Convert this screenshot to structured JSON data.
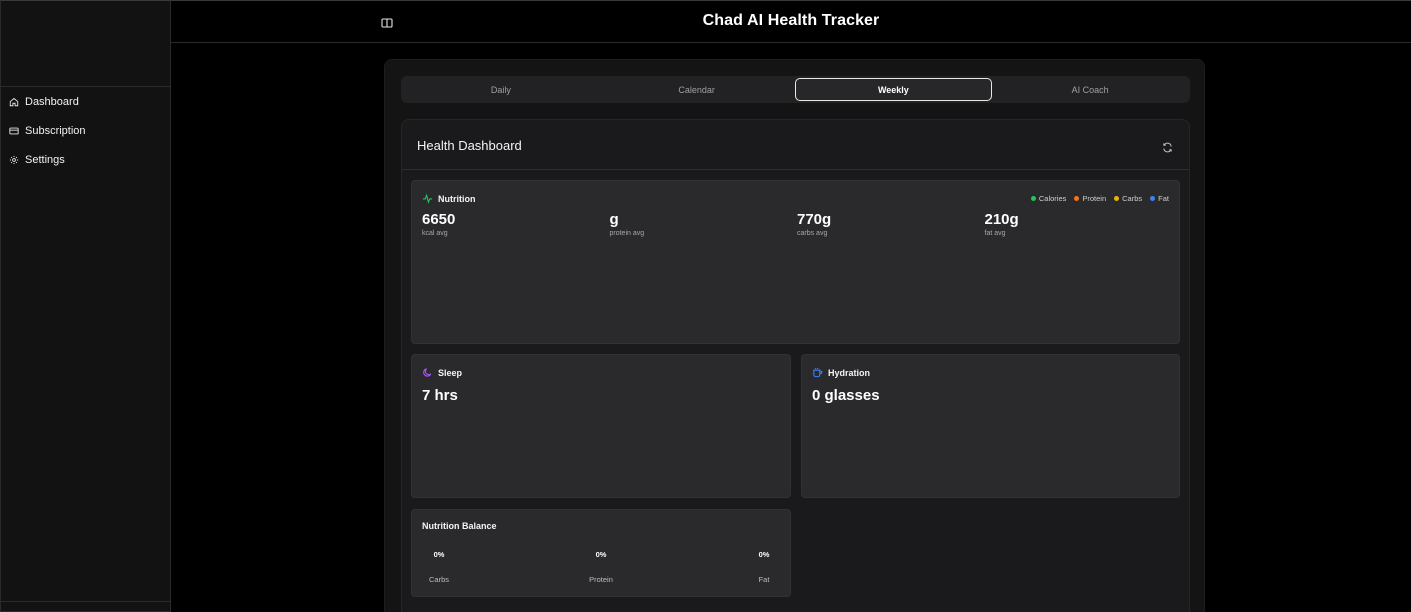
{
  "app": {
    "title": "Chad AI Health Tracker"
  },
  "sidebar": {
    "items": [
      {
        "label": "Dashboard",
        "icon": "home-icon"
      },
      {
        "label": "Subscription",
        "icon": "credit-card-icon"
      },
      {
        "label": "Settings",
        "icon": "gear-icon"
      }
    ]
  },
  "tabs": [
    {
      "label": "Daily",
      "active": false
    },
    {
      "label": "Calendar",
      "active": false
    },
    {
      "label": "Weekly",
      "active": true
    },
    {
      "label": "AI Coach",
      "active": false
    }
  ],
  "dashboard": {
    "title": "Health Dashboard",
    "nutrition": {
      "title": "Nutrition",
      "legend": [
        {
          "label": "Calories",
          "color": "#22c55e"
        },
        {
          "label": "Protein",
          "color": "#f97316"
        },
        {
          "label": "Carbs",
          "color": "#eab308"
        },
        {
          "label": "Fat",
          "color": "#3b82f6"
        }
      ],
      "stats": [
        {
          "value": "6650",
          "label": "kcal avg"
        },
        {
          "value": "g",
          "label": "protein avg"
        },
        {
          "value": "770g",
          "label": "carbs avg"
        },
        {
          "value": "210g",
          "label": "fat avg"
        }
      ]
    },
    "sleep": {
      "title": "Sleep",
      "value": "7 hrs"
    },
    "hydration": {
      "title": "Hydration",
      "value": "0 glasses"
    },
    "balance": {
      "title": "Nutrition Balance",
      "items": [
        {
          "pct": "0%",
          "name": "Carbs"
        },
        {
          "pct": "0%",
          "name": "Protein"
        },
        {
          "pct": "0%",
          "name": "Fat"
        }
      ]
    }
  },
  "colors": {
    "nutrition_icon": "#22c55e",
    "sleep_icon": "#a855f7",
    "hydration_icon": "#3b82f6"
  }
}
